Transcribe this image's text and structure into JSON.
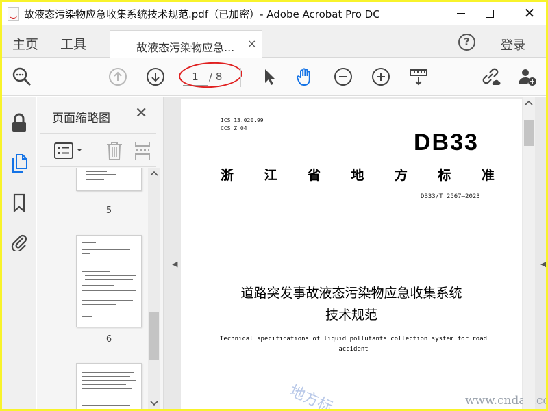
{
  "window": {
    "title": "故液态污染物应急收集系统技术规范.pdf（已加密）- Adobe Acrobat Pro DC",
    "minimize_icon": "minimize-icon",
    "maximize_icon": "maximize-icon",
    "close_label": "✕"
  },
  "tabbar": {
    "home_label": "主页",
    "tools_label": "工具",
    "doc_tab_label": "故液态污染物应急...",
    "doc_tab_close": "×",
    "help_label": "?",
    "login_label": "登录"
  },
  "toolbar": {
    "current_page": "1",
    "page_total": "/ 8",
    "icons": [
      "search-zoom-icon",
      "prev-page-icon",
      "next-page-icon",
      "select-pointer-icon",
      "hand-tool-icon",
      "zoom-out-icon",
      "zoom-in-icon",
      "page-fit-icon",
      "share-link-icon",
      "add-user-icon"
    ],
    "accent_color": "#1473e6",
    "annotation_color": "#e02020"
  },
  "rail": {
    "icons": [
      "lock-icon",
      "pages-icon",
      "bookmark-icon",
      "attachment-icon"
    ]
  },
  "thumbnails": {
    "title": "页面缩略图",
    "close_label": "✕",
    "items": [
      {
        "page": "5"
      },
      {
        "page": "6"
      }
    ]
  },
  "document": {
    "ics": "ICS  13.020.99",
    "ccs": "CCS  Z 04",
    "code": "DB33",
    "province_chars": [
      "浙",
      "江",
      "省",
      "地",
      "方",
      "标",
      "准"
    ],
    "std_number": "DB33/T 2567—2023",
    "title_line1": "道路突发事故液态污染物应急收集系统",
    "title_line2": "技术规范",
    "title_en": "Technical specifications of liquid pollutants collection system for road accident",
    "watermark_text": "地方标",
    "watermark_url": "www.cndao.com"
  }
}
